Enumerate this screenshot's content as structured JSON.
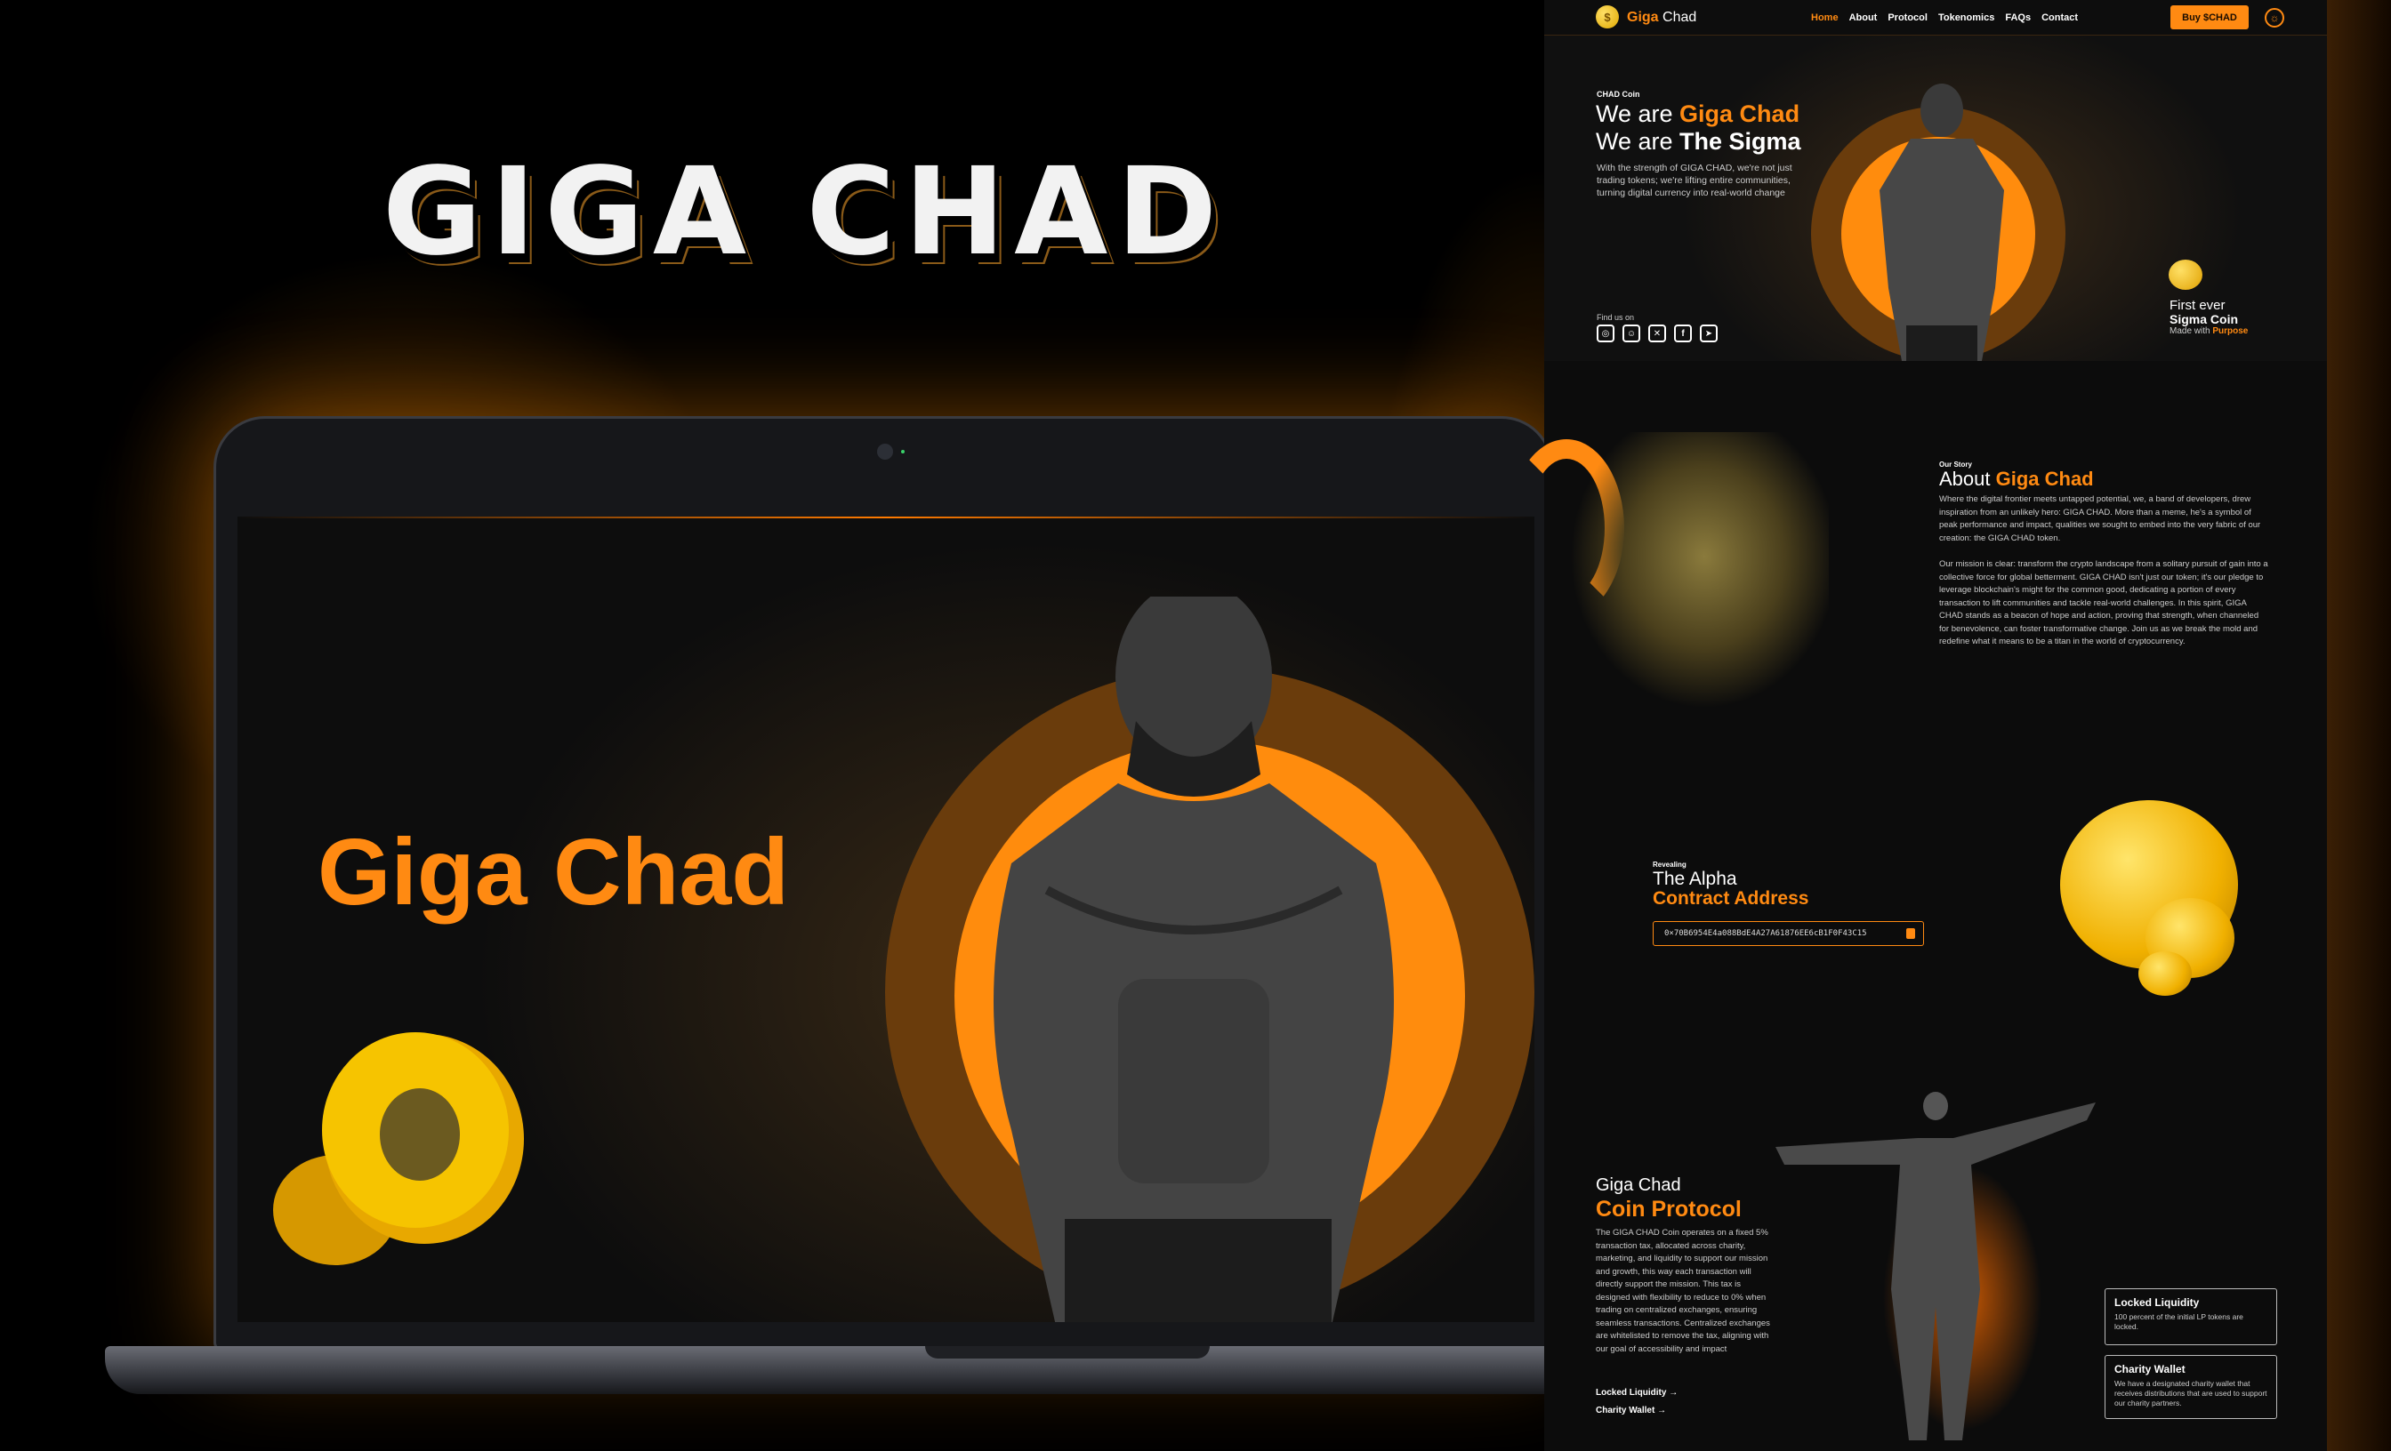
{
  "showcase": {
    "title": "GIGA CHAD",
    "screen_heading": "Giga Chad"
  },
  "nav": {
    "logo_mark": "$",
    "brand_primary": "Giga",
    "brand_secondary": "Chad",
    "links": [
      "Home",
      "About",
      "Protocol",
      "Tokenomics",
      "FAQs",
      "Contact"
    ],
    "active_link": "Home",
    "buy_button": "Buy $CHAD",
    "theme_icon": "sun-icon"
  },
  "hero": {
    "eyebrow": "CHAD Coin",
    "line1_prefix": "We are ",
    "line1_highlight": "Giga Chad",
    "line2_prefix": "We are ",
    "line2_highlight": "The Sigma",
    "paragraph": "With the strength of GIGA CHAD, we're not just trading tokens; we're lifting entire communities, turning digital currency into real-world change",
    "find_us": "Find us on",
    "socials": [
      "instagram-icon",
      "discord-icon",
      "x-icon",
      "facebook-icon",
      "telegram-icon"
    ],
    "first_ever": "First ever",
    "sigma_coin": "Sigma Coin",
    "made_with_prefix": "Made with ",
    "made_with_highlight": "Purpose"
  },
  "about": {
    "eyebrow": "Our Story",
    "title_prefix": "About ",
    "title_highlight": "Giga Chad",
    "paragraph1": "Where the digital frontier meets untapped potential, we, a band of developers, drew inspiration from an unlikely hero: GIGA CHAD. More than a meme, he's a symbol of peak performance and impact, qualities we sought to embed into the very fabric of our creation: the GIGA CHAD token.",
    "paragraph2": "Our mission is clear: transform the crypto landscape from a solitary pursuit of gain into a collective force for global betterment. GIGA CHAD isn't just our token; it's our pledge to leverage blockchain's might for the common good, dedicating a portion of every transaction to lift communities and tackle real-world challenges. In this spirit, GIGA CHAD stands as a beacon of hope and action, proving that strength, when channeled for benevolence, can foster transformative change. Join us as we break the mold and redefine what it means to be a titan in the world of cryptocurrency."
  },
  "contract": {
    "eyebrow": "Revealing",
    "line1": "The Alpha",
    "line2": "Contract Address",
    "address": "0×70B6954E4a088BdE4A27A61876EE6cB1F0F43C15",
    "copy_icon": "copy-icon"
  },
  "protocol": {
    "line1": "Giga Chad",
    "line2": "Coin Protocol",
    "paragraph": "The GIGA CHAD Coin operates on a fixed 5% transaction tax, allocated across charity, marketing, and liquidity to support our mission and growth, this way each transaction will directly support the mission. This tax is designed with flexibility to reduce to 0% when trading on centralized exchanges, ensuring seamless transactions. Centralized exchanges are whitelisted to remove the tax, aligning with our goal of accessibility and impact",
    "link1": "Locked Liquidity →",
    "link2": "Charity Wallet →",
    "cards": [
      {
        "title": "Locked Liquidity",
        "text": "100 percent of the initial LP tokens are locked."
      },
      {
        "title": "Charity Wallet",
        "text": "We have a designated charity wallet that receives distributions that are used to support our charity partners."
      }
    ]
  },
  "colors": {
    "accent": "#ff8a12",
    "ring_dark": "#6a3c0c",
    "background": "#0b0b0b"
  }
}
